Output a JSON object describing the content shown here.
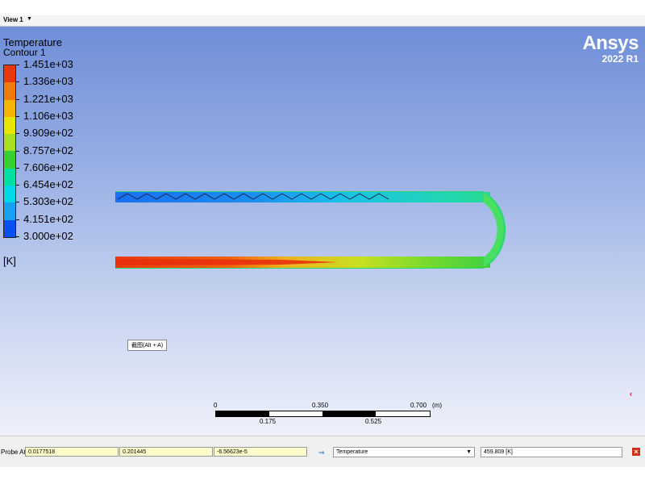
{
  "view_tab": {
    "label": "View 1",
    "menu_icon": "dropdown-triangle"
  },
  "legend": {
    "title": "Temperature",
    "subtitle": "Contour 1",
    "ticks": [
      "1.451e+03",
      "1.336e+03",
      "1.221e+03",
      "1.106e+03",
      "9.909e+02",
      "8.757e+02",
      "7.606e+02",
      "6.454e+02",
      "5.303e+02",
      "4.151e+02",
      "3.000e+02"
    ],
    "colors": [
      "#e8380d",
      "#f07a0a",
      "#f5b400",
      "#e6e600",
      "#a8e020",
      "#38d030",
      "#00e0a0",
      "#00d8e8",
      "#1aa0f0",
      "#0a50f0"
    ],
    "unit": "[K]"
  },
  "brand": {
    "name": "Ansys",
    "version": "2022 R1"
  },
  "tooltip": "截图(Alt + A)",
  "scale": {
    "top": [
      "0",
      "0.350",
      "0.700",
      "(m)"
    ],
    "bottom": [
      "0.175",
      "0.525"
    ]
  },
  "probe": {
    "label": "Probe At",
    "x": "0.0177518",
    "y": "0.201445",
    "z": "-6.56623e-5",
    "variable": "Temperature",
    "result": "459.809 [K]"
  }
}
